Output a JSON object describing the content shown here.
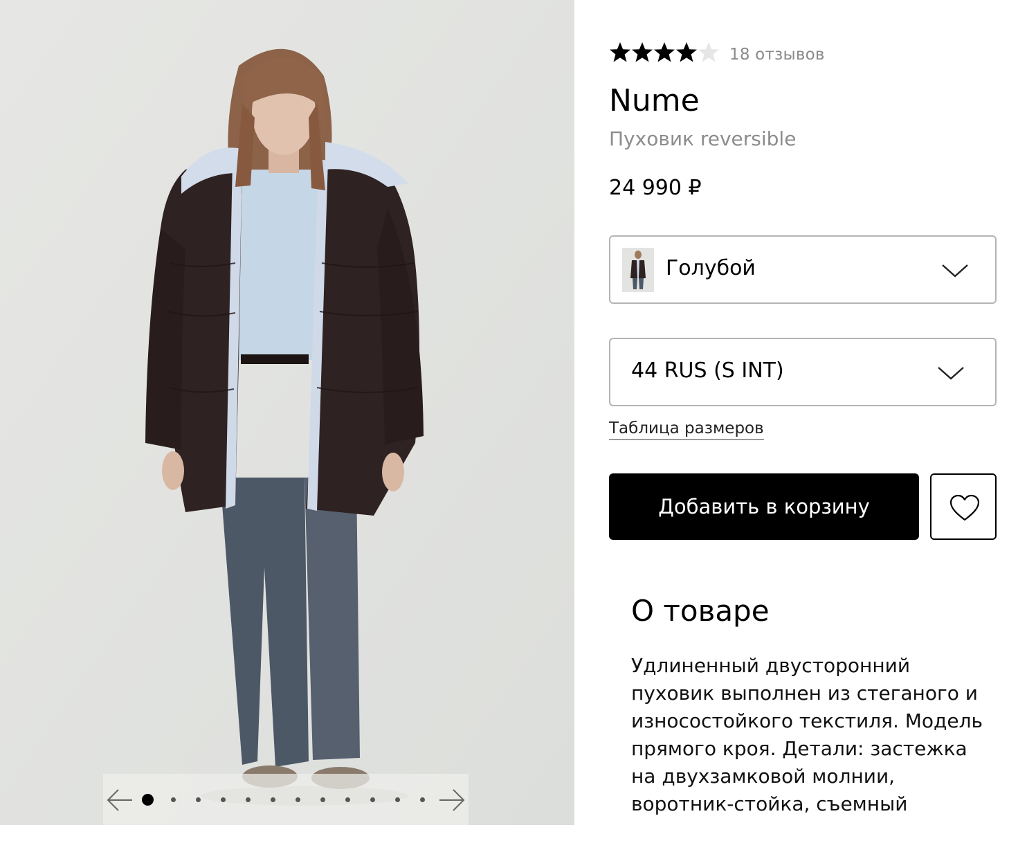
{
  "gallery": {
    "image_alt": "Woman wearing a dark brown oversized puffer coat with light blue lining, light blue sweater and grey-blue jeans",
    "prev_icon": "arrow-left-icon",
    "next_icon": "arrow-right-icon",
    "dot_count": 12,
    "active_index": 0
  },
  "product": {
    "rating": 4,
    "rating_max": 5,
    "reviews": "18 отзывов",
    "brand": "Nume",
    "name": "Пуховик reversible",
    "price": "24 990 ₽"
  },
  "color_select": {
    "selected": "Голубой",
    "icon": "chevron-down-icon"
  },
  "size_select": {
    "selected": "44 RUS (S INT)",
    "icon": "chevron-down-icon"
  },
  "size_table_link": "Таблица размеров",
  "add_to_cart": "Добавить в корзину",
  "favorite_icon": "heart-icon",
  "about": {
    "title": "О товаре",
    "text": "Удлиненный двусторонний пуховик выполнен из стеганого и износостойкого текстиля. Модель прямого кроя. Детали: застежка на двухзамковой молнии, воротник-стойка, съемный"
  },
  "colors": {
    "accent": "#000000",
    "muted": "#8c8c8c",
    "border": "#b4b4b4",
    "photo_bg": "#e3e4e1"
  }
}
